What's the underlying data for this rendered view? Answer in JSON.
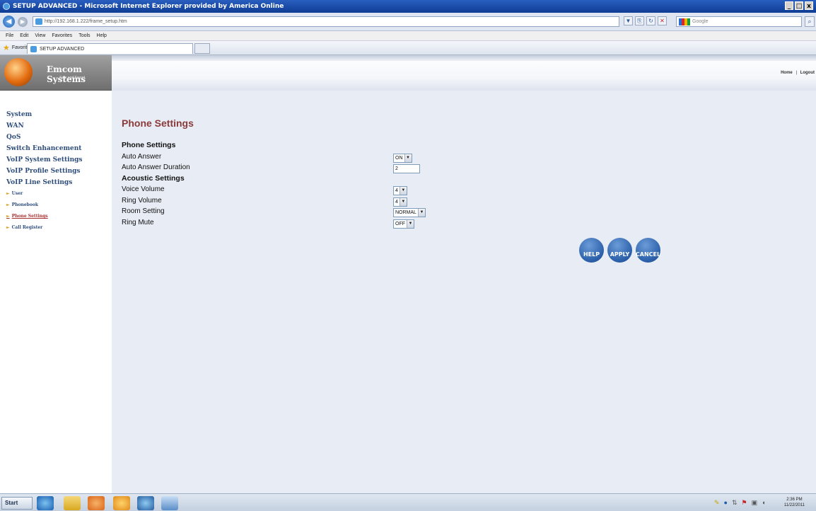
{
  "browser": {
    "title": "SETUP ADVANCED - Microsoft Internet Explorer provided by America Online",
    "window_controls": [
      "_",
      "□",
      "x"
    ],
    "url": "http://192.168.1.222/frame_setup.htm",
    "search_placeholder": "Google",
    "menu": [
      "File",
      "Edit",
      "View",
      "Favorites",
      "Tools",
      "Help"
    ],
    "favorites_label": "Favorites",
    "tab_title": "SETUP ADVANCED"
  },
  "header": {
    "logo_name": "Emcom Systems",
    "logo_tagline": "Safe and Sound.",
    "links": [
      "Home",
      "Logout"
    ],
    "link_separator": "|"
  },
  "sidebar": {
    "main_items": [
      {
        "label": "System"
      },
      {
        "label": "WAN"
      },
      {
        "label": "QoS"
      },
      {
        "label": "Switch Enhancement"
      },
      {
        "label": "VoIP System Settings"
      },
      {
        "label": "VoIP Profile Settings"
      },
      {
        "label": "VoIP Line Settings"
      }
    ],
    "sub_items": [
      {
        "label": "User",
        "active": false
      },
      {
        "label": "Phonebook",
        "active": false
      },
      {
        "label": "Phone Settings",
        "active": true
      },
      {
        "label": "Call Register",
        "active": false
      }
    ]
  },
  "main": {
    "page_title": "Phone Settings",
    "section_phone": "Phone Settings",
    "auto_answer_label": "Auto Answer",
    "auto_answer_value": "ON",
    "auto_answer_duration_label": "Auto Answer Duration",
    "auto_answer_duration_value": "2",
    "section_acoustic": "Acoustic Settings",
    "voice_volume_label": "Voice Volume",
    "voice_volume_value": "4",
    "ring_volume_label": "Ring Volume",
    "ring_volume_value": "4",
    "room_setting_label": "Room Setting",
    "room_setting_value": "NORMAL",
    "ring_mute_label": "Ring Mute",
    "ring_mute_value": "OFF",
    "buttons": {
      "help": "HELP",
      "apply": "APPLY",
      "cancel": "CANCEL"
    }
  },
  "taskbar": {
    "start_label": "Start",
    "time": "2:36 PM",
    "date": "11/22/2011"
  },
  "colors": {
    "nav_text": "#2e4d7b",
    "active_nav": "#a83232",
    "title_red": "#8a3a3a",
    "page_bg": "#e8ecf4",
    "button_blue": "#2a5fa8"
  }
}
